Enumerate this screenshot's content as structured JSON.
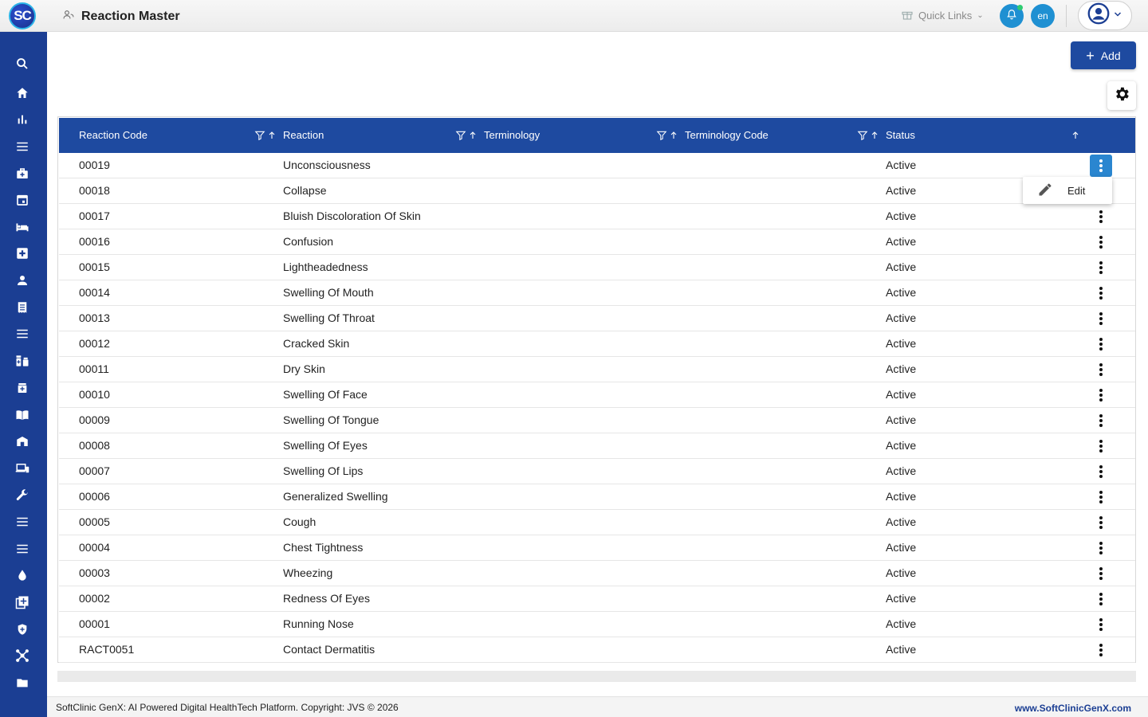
{
  "app": {
    "logo_text": "SC",
    "page_title": "Reaction Master"
  },
  "topbar": {
    "quick_links": "Quick Links",
    "lang": "en"
  },
  "toolbar": {
    "add_label": "Add"
  },
  "table": {
    "columns": [
      "Reaction Code",
      "Reaction",
      "Terminology",
      "Terminology Code",
      "Status"
    ],
    "rows": [
      [
        "00019",
        "Unconsciousness",
        "",
        "",
        "Active"
      ],
      [
        "00018",
        "Collapse",
        "",
        "",
        "Active"
      ],
      [
        "00017",
        "Bluish Discoloration Of Skin",
        "",
        "",
        "Active"
      ],
      [
        "00016",
        "Confusion",
        "",
        "",
        "Active"
      ],
      [
        "00015",
        "Lightheadedness",
        "",
        "",
        "Active"
      ],
      [
        "00014",
        "Swelling Of Mouth",
        "",
        "",
        "Active"
      ],
      [
        "00013",
        "Swelling Of Throat",
        "",
        "",
        "Active"
      ],
      [
        "00012",
        "Cracked Skin",
        "",
        "",
        "Active"
      ],
      [
        "00011",
        "Dry Skin",
        "",
        "",
        "Active"
      ],
      [
        "00010",
        "Swelling Of Face",
        "",
        "",
        "Active"
      ],
      [
        "00009",
        "Swelling Of Tongue",
        "",
        "",
        "Active"
      ],
      [
        "00008",
        "Swelling Of Eyes",
        "",
        "",
        "Active"
      ],
      [
        "00007",
        "Swelling Of Lips",
        "",
        "",
        "Active"
      ],
      [
        "00006",
        "Generalized Swelling",
        "",
        "",
        "Active"
      ],
      [
        "00005",
        "Cough",
        "",
        "",
        "Active"
      ],
      [
        "00004",
        "Chest Tightness",
        "",
        "",
        "Active"
      ],
      [
        "00003",
        "Wheezing",
        "",
        "",
        "Active"
      ],
      [
        "00002",
        "Redness Of Eyes",
        "",
        "",
        "Active"
      ],
      [
        "00001",
        "Running Nose",
        "",
        "",
        "Active"
      ],
      [
        "RACT0051",
        "Contact Dermatitis",
        "",
        "",
        "Active"
      ]
    ]
  },
  "row_menu": {
    "edit_label": "Edit"
  },
  "sidebar": {
    "icons": [
      "search-icon",
      "home-icon",
      "bar-chart-icon",
      "menu-icon",
      "medical-bag-icon",
      "calendar-icon",
      "bed-icon",
      "medical-plus-icon",
      "person-icon",
      "receipt-icon",
      "list-icon",
      "pharmacy-icon",
      "medicine-box-icon",
      "book-icon",
      "store-icon",
      "devices-icon",
      "wrench-icon",
      "list-icon",
      "list-icon",
      "drop-icon",
      "add-box-icon",
      "shield-icon",
      "hub-icon",
      "folder-icon"
    ]
  },
  "footer": {
    "left": "SoftClinic GenX: AI Powered Digital HealthTech Platform. Copyright: JVS © 2026",
    "right": "www.SoftClinicGenX.com"
  },
  "colors": {
    "primary": "#1e4aa0",
    "sidebar": "#1b3e93",
    "accent": "#1f90d2"
  }
}
